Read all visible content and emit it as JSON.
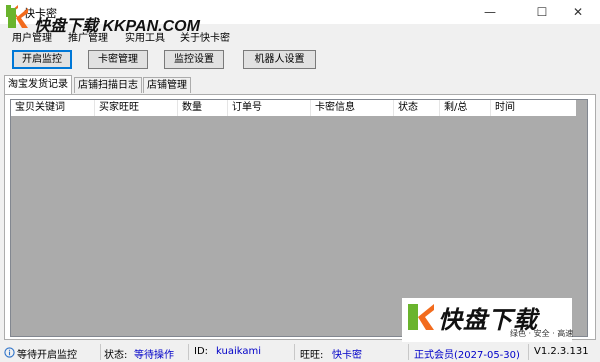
{
  "window": {
    "title": "快卡密",
    "minimize_symbol": "—",
    "maximize_symbol": "☐",
    "close_symbol": "✕"
  },
  "watermark": {
    "text": "快盘下载 KKPAN.COM",
    "brand_big": "快盘下载",
    "brand_small": "绿色 · 安全 · 高速"
  },
  "menu": {
    "items": [
      "用户管理",
      "推广管理",
      "实用工具",
      "关于快卡密"
    ]
  },
  "toolbar": {
    "buttons": [
      "开启监控",
      "卡密管理",
      "监控设置",
      "机器人设置"
    ]
  },
  "tabs": [
    "淘宝发货记录",
    "店铺扫描日志",
    "店铺管理"
  ],
  "table": {
    "columns": [
      "宝贝关键词",
      "买家旺旺",
      "数量",
      "订单号",
      "卡密信息",
      "状态",
      "剩/总",
      "时间"
    ]
  },
  "status": {
    "message": "等待开启监控",
    "state_label": "状态:",
    "state_value": "等待操作",
    "id_label": "ID:",
    "id_value": "kuaikami",
    "wangwang_label": "旺旺:",
    "wangwang_value": "快卡密",
    "membership": "正式会员(2027-05-30)",
    "version": "V1.2.3.131"
  },
  "colors": {
    "accent": "#0078d7",
    "grid_bg": "#ababab",
    "status_link": "#0000c8",
    "logo_orange": "#f26b1d",
    "logo_green": "#6ab42d"
  },
  "icons": {
    "app": "app-logo-icon",
    "status": "info-circle-icon"
  }
}
